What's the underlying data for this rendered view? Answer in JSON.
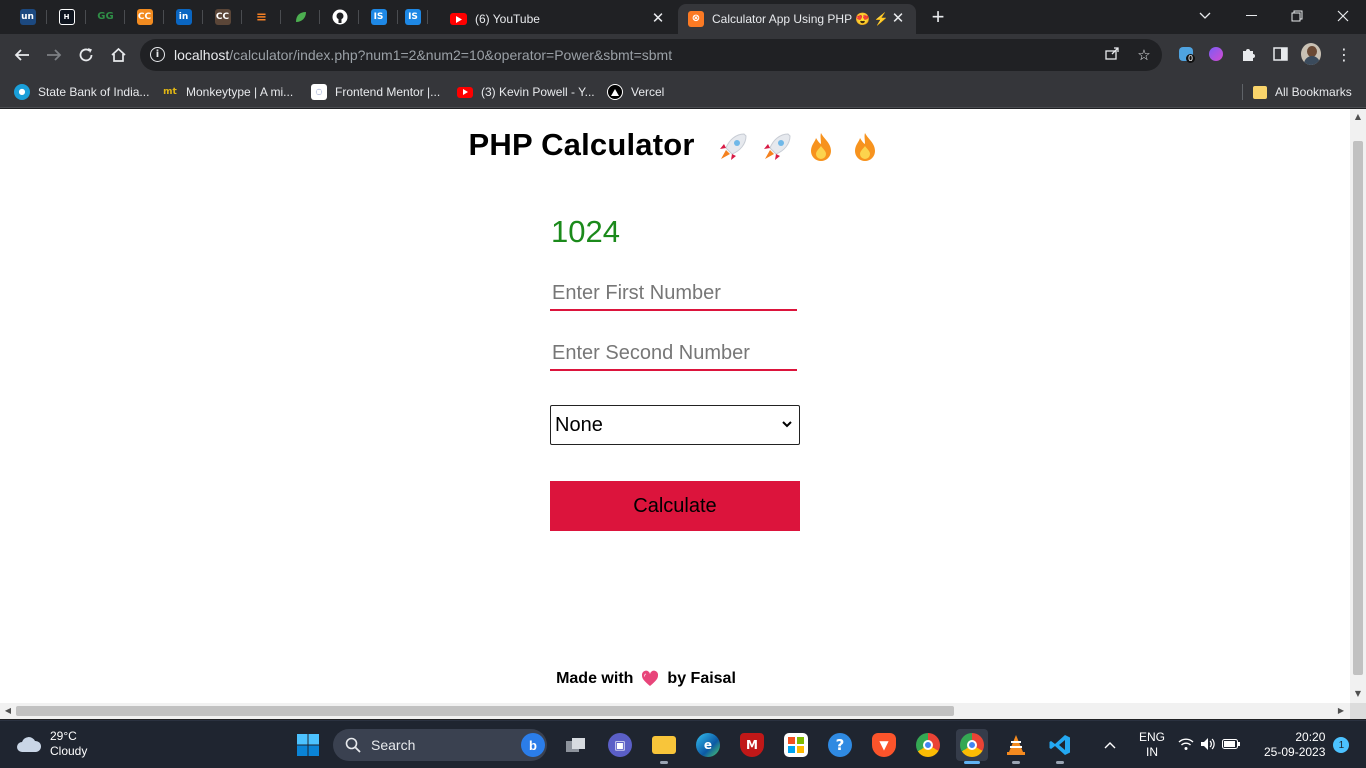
{
  "browser": {
    "pinned_tabs": [
      {
        "name": "unstop",
        "label": "un",
        "color": "#1c4980"
      },
      {
        "name": "hackerrank",
        "label": "HR",
        "color": "#0e141e"
      },
      {
        "name": "geeksforgeeks",
        "label": "GfG",
        "color": "#2f8d46"
      },
      {
        "name": "codechef",
        "label": "CC",
        "color": "#f28b20"
      },
      {
        "name": "linkedin",
        "label": "in",
        "color": "#0a66c2"
      },
      {
        "name": "codechef-cc",
        "label": "CC",
        "color": "#5b4638"
      },
      {
        "name": "stack-overflow",
        "label": "SO",
        "color": "#f48024"
      },
      {
        "name": "leaf",
        "label": "",
        "color": "#4caf50"
      },
      {
        "name": "github",
        "label": "",
        "color": "#ffffff"
      },
      {
        "name": "infosys-springboard",
        "label": "IS",
        "color": "#1e88e5"
      },
      {
        "name": "infosys-springboard-2",
        "label": "IS",
        "color": "#1e88e5"
      }
    ],
    "tabs": [
      {
        "title": "(6) YouTube",
        "icon": "youtube-icon",
        "active": false
      },
      {
        "title": "Calculator App Using PHP 😍 ⚡",
        "icon": "xampp-icon",
        "active": true
      }
    ],
    "url_host": "localhost",
    "url_path": "/calculator/index.php?num1=2&num2=10&operator=Power&sbmt=sbmt",
    "bookmarks": [
      {
        "label": "State Bank of India...",
        "icon": "sbi-icon",
        "color": "#1a9fd9"
      },
      {
        "label": "Monkeytype | A mi...",
        "icon": "monkeytype-icon",
        "color": "#e2b714"
      },
      {
        "label": "Frontend Mentor |...",
        "icon": "frontend-mentor-icon",
        "color": "#ffffff"
      },
      {
        "label": "(3) Kevin Powell - Y...",
        "icon": "youtube-icon",
        "color": "#ff0000"
      },
      {
        "label": "Vercel",
        "icon": "vercel-icon",
        "color": "#000000"
      }
    ],
    "all_bookmarks": "All Bookmarks"
  },
  "page": {
    "title": "PHP Calculator",
    "result": "1024",
    "first_placeholder": "Enter First Number",
    "second_placeholder": "Enter Second Number",
    "operator_selected": "None",
    "calculate_label": "Calculate",
    "footer_prefix": "Made with",
    "footer_suffix": "by Faisal",
    "accent_color": "#dc143c",
    "result_color": "#1b8a1b"
  },
  "taskbar": {
    "temperature": "29°C",
    "weather": "Cloudy",
    "search_label": "Search",
    "language": "ENG",
    "region": "IN",
    "time": "20:20",
    "date": "25-09-2023",
    "notification_count": "1",
    "extension_badge": "0"
  }
}
